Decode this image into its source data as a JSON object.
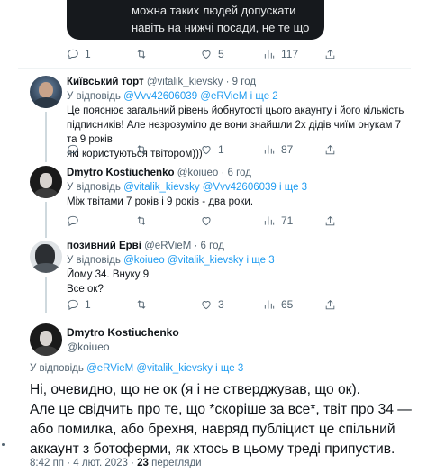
{
  "top_tweet": {
    "text_line1": "можна таких людей допускати",
    "text_line2": "навіть на нижчі посади, не те що",
    "actions": {
      "replies": "1",
      "retweets": "",
      "likes": "5",
      "views": "117"
    }
  },
  "replies": [
    {
      "name": "Київський торт",
      "handle": "@vitalik_kievsky",
      "time": "9 год",
      "reply_prefix": "У відповідь",
      "reply_to": "@Vvv42606039 @eRVieM і ще 2",
      "text_lines": [
        "Це пояснює загальний рівень йобнутості цього акаунту і його кількість",
        "підписників! Але незрозуміло де вони знайшли 2х дідів чиїм онукам 7 та 9 років",
        "які користуються твітором)))"
      ],
      "actions": {
        "replies": "",
        "retweets": "",
        "likes": "1",
        "views": "87"
      }
    },
    {
      "name": "Dmytro Kostiuchenko",
      "handle": "@koiueo",
      "time": "6 год",
      "reply_prefix": "У відповідь",
      "reply_to": "@vitalik_kievsky @Vvv42606039 і ще 3",
      "text_lines": [
        "Між твітами 7 років і 9 років - два роки."
      ],
      "actions": {
        "replies": "",
        "retweets": "",
        "likes": "",
        "views": "71"
      }
    },
    {
      "name": "позивний Ерві",
      "handle": "@eRVieM",
      "time": "6 год",
      "reply_prefix": "У відповідь",
      "reply_to": "@koiueo @vitalik_kievsky і ще 3",
      "text_lines": [
        "Йому 34. Внуку 9",
        "Все ок?"
      ],
      "actions": {
        "replies": "1",
        "retweets": "",
        "likes": "3",
        "views": "65"
      }
    }
  ],
  "main_tweet": {
    "name": "Dmytro Kostiuchenko",
    "handle": "@koiueo",
    "reply_prefix": "У відповідь",
    "reply_to": "@eRVieM @vitalik_kievsky і ще 3",
    "text_lines": [
      "Ні, очевидно, що не ок (я і не стверджував, що ок).",
      "Але це свідчить про те, що *скоріше за все*, твіт про 34 —",
      "або помилка, або брехня, навряд публіцист це спільний",
      "аккаунт з ботоферми, як хтось в цьому треді припустив."
    ],
    "time": "8:42 пп",
    "date": "4 лют. 2023",
    "views_count": "23",
    "views_label": "перегляди"
  },
  "icons": [
    "reply-icon",
    "retweet-icon",
    "like-icon",
    "views-icon",
    "share-icon"
  ],
  "colors": {
    "link": "#1d9bf0",
    "muted": "#536471",
    "text": "#0f1419",
    "divider": "#eff3f4",
    "thread_line": "#cfd9de"
  }
}
